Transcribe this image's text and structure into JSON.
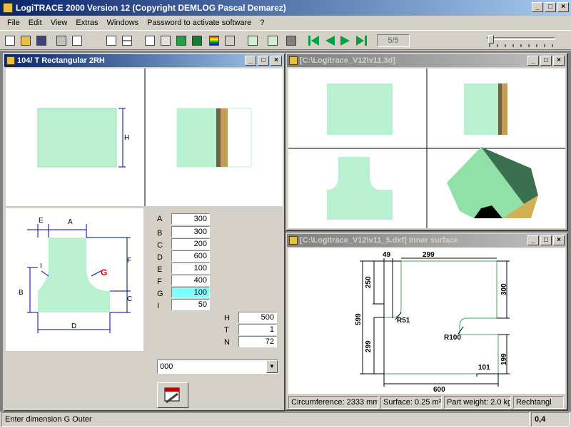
{
  "app": {
    "title": "LogiTRACE 2000  Version 12  (Copyright DEMLOG Pascal Demarez)"
  },
  "menu": [
    "File",
    "Edit",
    "View",
    "Extras",
    "Windows",
    "Password to activate software",
    "?"
  ],
  "toolbar": {
    "page": "5/5"
  },
  "win_left": {
    "title": "104/ T Rectangular 2RH",
    "dim_labels": {
      "H": "H",
      "A": "A",
      "E": "E",
      "F": "F",
      "I": "I",
      "G": "G",
      "B": "B",
      "C": "C",
      "D": "D"
    },
    "params": [
      {
        "label": "A",
        "value": "300"
      },
      {
        "label": "B",
        "value": "300"
      },
      {
        "label": "C",
        "value": "200"
      },
      {
        "label": "D",
        "value": "600"
      },
      {
        "label": "E",
        "value": "100"
      },
      {
        "label": "F",
        "value": "400"
      },
      {
        "label": "G",
        "value": "100"
      },
      {
        "label": "I",
        "value": "50"
      }
    ],
    "params2": [
      {
        "label": "H",
        "value": "500"
      },
      {
        "label": "T",
        "value": "1"
      },
      {
        "label": "N",
        "value": "72"
      }
    ],
    "combo": "000"
  },
  "win_3d": {
    "title": "[C:\\Logitrace_V12\\v11.3d]"
  },
  "win_dxf": {
    "title": "[C:\\Logitrace_V12\\v11_5.dxf]  Inner surface",
    "dims": {
      "d49": "49",
      "d299": "299",
      "d250": "250",
      "d300": "300",
      "d599": "599",
      "r51": "R51",
      "r100": "R100",
      "d299b": "299",
      "d199": "199",
      "d101": "101",
      "d600": "600"
    },
    "info": {
      "circumference": "Circumference: 2333 mm",
      "surface": "Surface: 0.25 m²",
      "weight": "Part weight: 2.0 kg",
      "shape": "Rechtangl"
    }
  },
  "status": {
    "message": "Enter dimension G Outer",
    "coords": "0,4"
  },
  "colors": {
    "mint": "#b8f0d0",
    "dark_green": "#3a7050",
    "red_label": "#cc0000"
  }
}
